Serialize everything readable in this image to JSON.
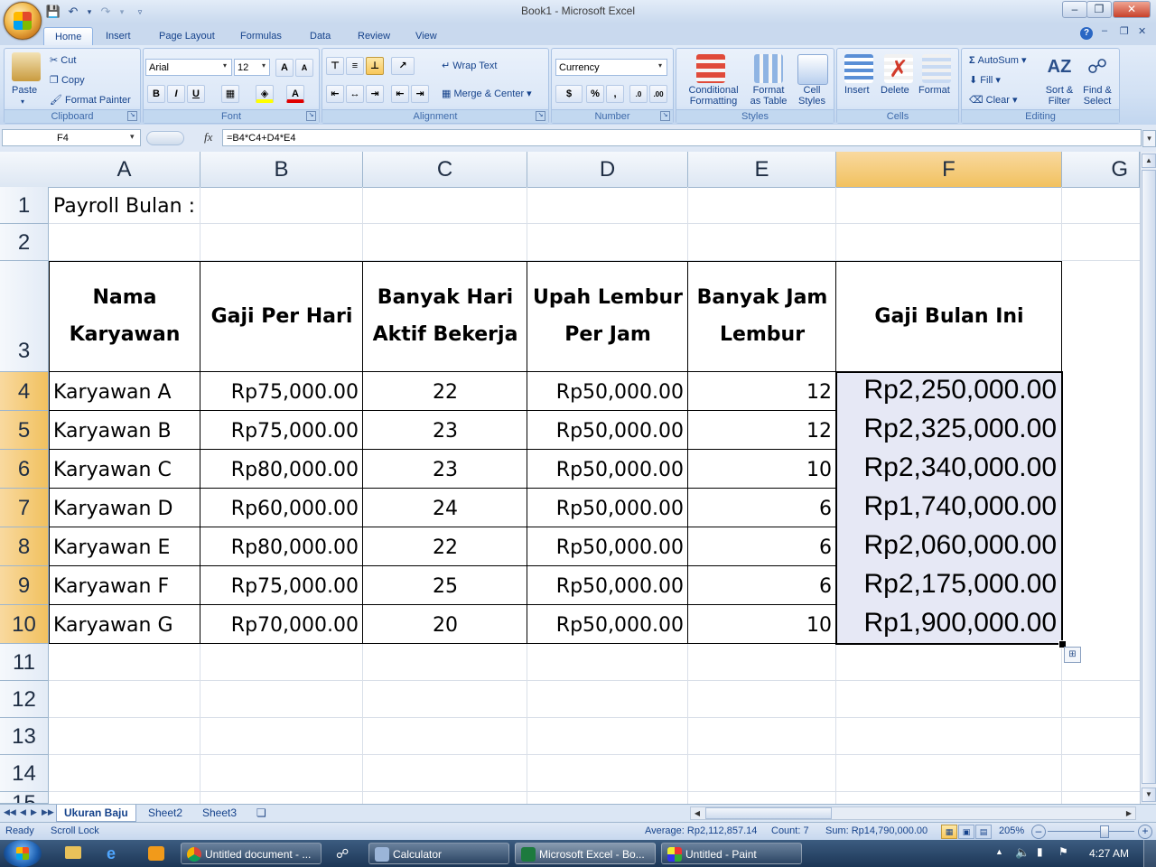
{
  "window": {
    "title": "Book1 - Microsoft Excel"
  },
  "tabs": [
    "Home",
    "Insert",
    "Page Layout",
    "Formulas",
    "Data",
    "Review",
    "View"
  ],
  "ribbon": {
    "clipboard": {
      "paste": "Paste",
      "cut": "Cut",
      "copy": "Copy",
      "format_painter": "Format Painter",
      "label": "Clipboard"
    },
    "font": {
      "name": "Arial",
      "size": "12",
      "label": "Font"
    },
    "alignment": {
      "wrap_text": "Wrap Text",
      "merge_center": "Merge & Center",
      "label": "Alignment"
    },
    "number": {
      "format": "Currency",
      "label": "Number"
    },
    "styles": {
      "conditional": [
        "Conditional",
        "Formatting"
      ],
      "format_table": [
        "Format",
        "as Table"
      ],
      "cell_styles": [
        "Cell",
        "Styles"
      ],
      "label": "Styles"
    },
    "cells": {
      "insert": "Insert",
      "delete": "Delete",
      "format": "Format",
      "label": "Cells"
    },
    "editing": {
      "autosum": "AutoSum",
      "fill": "Fill",
      "clear": "Clear",
      "sort": [
        "Sort &",
        "Filter"
      ],
      "find": [
        "Find &",
        "Select"
      ],
      "label": "Editing"
    }
  },
  "formula_bar": {
    "name_box": "F4",
    "fx": "fx",
    "formula": "=B4*C4+D4*E4"
  },
  "columns": [
    "A",
    "B",
    "C",
    "D",
    "E",
    "F",
    "G"
  ],
  "rows": [
    "1",
    "2",
    "3",
    "4",
    "5",
    "6",
    "7",
    "8",
    "9",
    "10",
    "11",
    "12",
    "13",
    "14",
    "15"
  ],
  "sheet": {
    "title": "Payroll Bulan :",
    "headers": [
      [
        "Nama",
        "Karyawan"
      ],
      [
        "Gaji Per Hari"
      ],
      [
        "Banyak Hari",
        "Aktif Bekerja"
      ],
      [
        "Upah Lembur",
        "Per Jam"
      ],
      [
        "Banyak Jam",
        "Lembur"
      ],
      [
        "Gaji Bulan Ini"
      ]
    ],
    "data": [
      [
        "Karyawan A",
        "Rp75,000.00",
        "22",
        "Rp50,000.00",
        "12",
        "Rp2,250,000.00"
      ],
      [
        "Karyawan B",
        "Rp75,000.00",
        "23",
        "Rp50,000.00",
        "12",
        "Rp2,325,000.00"
      ],
      [
        "Karyawan C",
        "Rp80,000.00",
        "23",
        "Rp50,000.00",
        "10",
        "Rp2,340,000.00"
      ],
      [
        "Karyawan D",
        "Rp60,000.00",
        "24",
        "Rp50,000.00",
        "6",
        "Rp1,740,000.00"
      ],
      [
        "Karyawan E",
        "Rp80,000.00",
        "22",
        "Rp50,000.00",
        "6",
        "Rp2,060,000.00"
      ],
      [
        "Karyawan F",
        "Rp75,000.00",
        "25",
        "Rp50,000.00",
        "6",
        "Rp2,175,000.00"
      ],
      [
        "Karyawan G",
        "Rp70,000.00",
        "20",
        "Rp50,000.00",
        "10",
        "Rp1,900,000.00"
      ]
    ]
  },
  "sheet_tabs": [
    "Ukuran Baju",
    "Sheet2",
    "Sheet3"
  ],
  "status": {
    "ready": "Ready",
    "scroll_lock": "Scroll Lock",
    "average": "Average: Rp2,112,857.14",
    "count": "Count: 7",
    "sum": "Sum: Rp14,790,000.00",
    "zoom": "205%"
  },
  "taskbar": {
    "items": [
      "Untitled document - ...",
      "Calculator",
      "Microsoft Excel - Bo...",
      "Untitled - Paint"
    ],
    "clock": "4:27 AM"
  },
  "colors": {
    "selected_header": "#f1c15f",
    "ribbon": "#dbe7f7",
    "selection_fill": "#e6e8f5"
  }
}
